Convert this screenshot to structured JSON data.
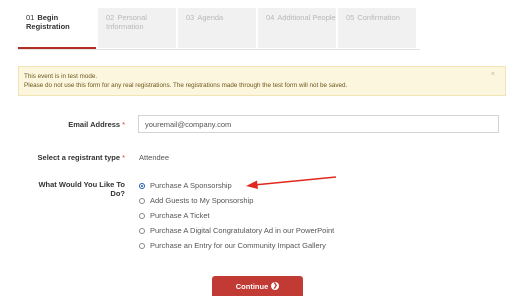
{
  "steps": [
    {
      "num": "01",
      "label": "Begin Registration"
    },
    {
      "num": "02",
      "label": "Personal Information"
    },
    {
      "num": "03",
      "label": "Agenda"
    },
    {
      "num": "04",
      "label": "Additional People"
    },
    {
      "num": "05",
      "label": "Confirmation"
    }
  ],
  "alert": {
    "line1": "This event is in test mode.",
    "line2": "Please do not use this form for any real registrations. The registrations made through the test form will not be saved.",
    "close": "×"
  },
  "form": {
    "email_label": "Email Address",
    "email_value": "youremail@company.com",
    "registrant_type_label": "Select a registrant type",
    "registrant_type_value": "Attendee",
    "required_mark": "*",
    "would_like_label": "What Would You Like To Do?",
    "options": [
      "Purchase A Sponsorship",
      "Add Guests to My Sponsorship",
      "Purchase A Ticket",
      "Purchase A Digital Congratulatory Ad in our PowerPoint",
      "Purchase an Entry for our Community Impact Gallery"
    ],
    "selected_option": "Purchase A Sponsorship"
  },
  "continue_button": {
    "label": "Continue",
    "icon": "chevron-right-icon"
  },
  "colors": {
    "accent": "#c13a33",
    "annotation_arrow": "#e0281f",
    "alert_bg": "#fcf6df"
  }
}
